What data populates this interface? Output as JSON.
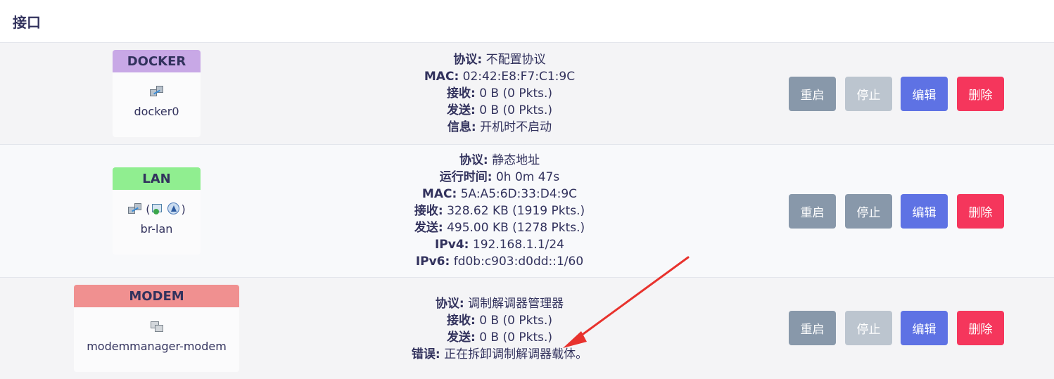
{
  "page": {
    "title": "接口"
  },
  "buttons": {
    "restart": "重启",
    "stop": "停止",
    "edit": "编辑",
    "delete": "删除"
  },
  "colors": {
    "docker_head": "#c8a8e6",
    "lan_head": "#90ee90",
    "modem_head": "#f09090",
    "restart": "#8898aa",
    "stop_disabled": "#bcc5cf",
    "edit": "#5e72e4",
    "delete": "#f5365c",
    "annotation_arrow": "#e8322d"
  },
  "interfaces": [
    {
      "label": "DOCKER",
      "icon": "network-port-icon",
      "device": "docker0",
      "stop_disabled": true,
      "info": [
        {
          "key": "协议:",
          "value": "不配置协议"
        },
        {
          "key": "MAC:",
          "value": "02:42:E8:F7:C1:9C"
        },
        {
          "key": "接收:",
          "value": "0 B (0 Pkts.)"
        },
        {
          "key": "发送:",
          "value": "0 B (0 Pkts.)"
        },
        {
          "key": "信息:",
          "value": "开机时不启动"
        }
      ]
    },
    {
      "label": "LAN",
      "icon": "network-port-icon",
      "icon_group_open": "(",
      "icon_group_close": ")",
      "device": "br-lan",
      "stop_disabled": false,
      "info": [
        {
          "key": "协议:",
          "value": "静态地址"
        },
        {
          "key": "运行时间:",
          "value": "0h 0m 47s"
        },
        {
          "key": "MAC:",
          "value": "5A:A5:6D:33:D4:9C"
        },
        {
          "key": "接收:",
          "value": "328.62 KB (1919 Pkts.)"
        },
        {
          "key": "发送:",
          "value": "495.00 KB (1278 Pkts.)"
        },
        {
          "key": "IPv4:",
          "value": "192.168.1.1/24"
        },
        {
          "key": "IPv6:",
          "value": "fd0b:c903:d0dd::1/60"
        }
      ]
    },
    {
      "label": "MODEM",
      "icon": "modem-icon",
      "device": "modemmanager-modem",
      "stop_disabled": true,
      "info": [
        {
          "key": "协议:",
          "value": "调制解调器管理器"
        },
        {
          "key": "接收:",
          "value": "0 B (0 Pkts.)"
        },
        {
          "key": "发送:",
          "value": "0 B (0 Pkts.)"
        },
        {
          "key": "错误:",
          "value": "正在拆卸调制解调器载体。"
        }
      ]
    }
  ]
}
